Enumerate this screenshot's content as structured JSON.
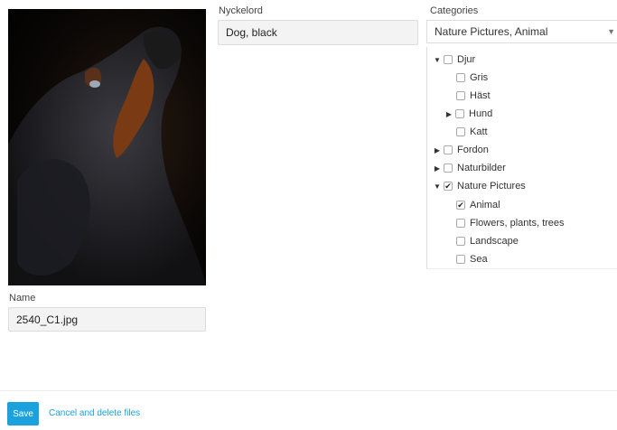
{
  "fields": {
    "keywords_label": "Nyckelord",
    "keywords_value": "Dog, black",
    "categories_label": "Categories",
    "categories_value": "Nature Pictures, Animal",
    "name_label": "Name",
    "name_value": "2540_C1.jpg"
  },
  "tree": [
    {
      "label": "Djur",
      "caret": "down",
      "checked": false
    },
    {
      "label": "Gris",
      "caret": "none",
      "checked": false
    },
    {
      "label": "Häst",
      "caret": "none",
      "checked": false
    },
    {
      "label": "Hund",
      "caret": "right",
      "checked": false
    },
    {
      "label": "Katt",
      "caret": "none",
      "checked": false
    },
    {
      "label": "Fordon",
      "caret": "right",
      "checked": false
    },
    {
      "label": "Naturbilder",
      "caret": "right",
      "checked": false
    },
    {
      "label": "Nature Pictures",
      "caret": "down",
      "checked": true
    },
    {
      "label": "Animal",
      "caret": "none",
      "checked": true
    },
    {
      "label": "Flowers, plants, trees",
      "caret": "none",
      "checked": false
    },
    {
      "label": "Landscape",
      "caret": "none",
      "checked": false
    },
    {
      "label": "Sea",
      "caret": "none",
      "checked": false
    }
  ],
  "actions": {
    "save_label": "Save",
    "cancel_label": "Cancel and delete files"
  },
  "colors": {
    "accent": "#1ba1dc"
  }
}
